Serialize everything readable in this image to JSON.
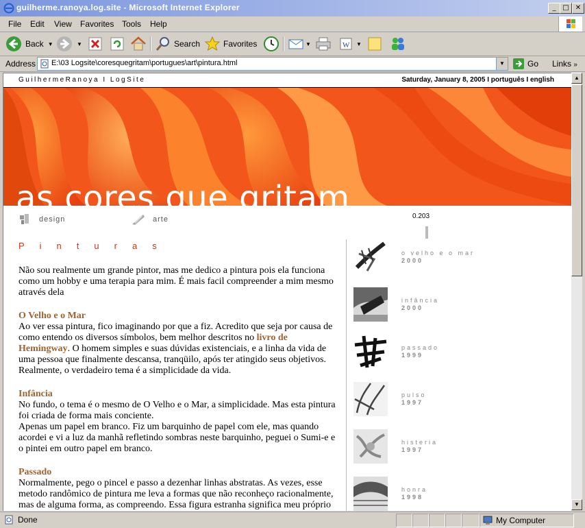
{
  "window": {
    "title": "guilherme.ranoya.log.site - Microsoft Internet Explorer",
    "minimize": "_",
    "maximize": "□",
    "close": "✕"
  },
  "menu": [
    "File",
    "Edit",
    "View",
    "Favorites",
    "Tools",
    "Help"
  ],
  "toolbar": {
    "back": "Back",
    "search": "Search",
    "favorites": "Favorites"
  },
  "address": {
    "label": "Address",
    "url": "E:\\03 Logsite\\coresquegritam\\portugues\\art\\pintura.html",
    "go": "Go",
    "links": "Links"
  },
  "page": {
    "site_name": "GuilhermeRanoya I LogSite",
    "date_lang": "Saturday, January 8, 2005 I português I english",
    "banner_title": "as cores que gritam",
    "nav": [
      {
        "label": "design"
      },
      {
        "label": "arte"
      }
    ],
    "counter": "0.203",
    "heading": "Pinturas",
    "intro": "Não sou realmente um grande pintor, mas me dedico a pintura pois ela funciona como um hobby e uma terapia para mim. É mais facil compreender a mim mesmo através dela",
    "sections": [
      {
        "title": "O Velho e o Mar",
        "text_before": "Ao ver essa pintura, fico imaginando por que a fiz. Acredito que seja por causa de como entendo os diversos símbolos, bem melhor descritos no ",
        "link": "livro de Hemingway",
        "text_after": ". O homem simples e suas dúvidas existenciais, e a linha da vida de uma pessoa que finalmente descansa, tranqüilo, após ter atingido seus objetivos.",
        "text_2": "Realmente, o verdadeiro tema é a simplicidade da vida."
      },
      {
        "title": "Infância",
        "text_before": "No fundo, o tema é o mesmo de O Velho e o Mar, a simplicidade. Mas esta pintura foi criada de forma mais conciente.",
        "text_2": "Apenas um papel em branco. Fiz um barquinho de papel com ele, mas quando acordei e vi a luz da manhã refletindo sombras neste barquinho, peguei o Sumi-e e o pintei em outro papel em branco."
      },
      {
        "title": "Passado",
        "text_before": "Normalmente, pego o pincel e passo a dezenhar linhas abstratas. As vezes, esse metodo randômico de pintura me leva a formas que não reconheço racionalmente, mas de alguma forma, as compreendo. Essa figura estranha significa meu próprio passado, mas não me pergunte como eu sei isto, pois não faço a menor idéia."
      }
    ],
    "gallery": [
      {
        "name": "o velho e o mar",
        "year": "2000"
      },
      {
        "name": "infância",
        "year": "2000"
      },
      {
        "name": "passado",
        "year": "1999"
      },
      {
        "name": "pulso",
        "year": "1997"
      },
      {
        "name": "histeria",
        "year": "1997"
      },
      {
        "name": "honra",
        "year": "1998"
      }
    ]
  },
  "status": {
    "text": "Done",
    "zone": "My Computer"
  }
}
